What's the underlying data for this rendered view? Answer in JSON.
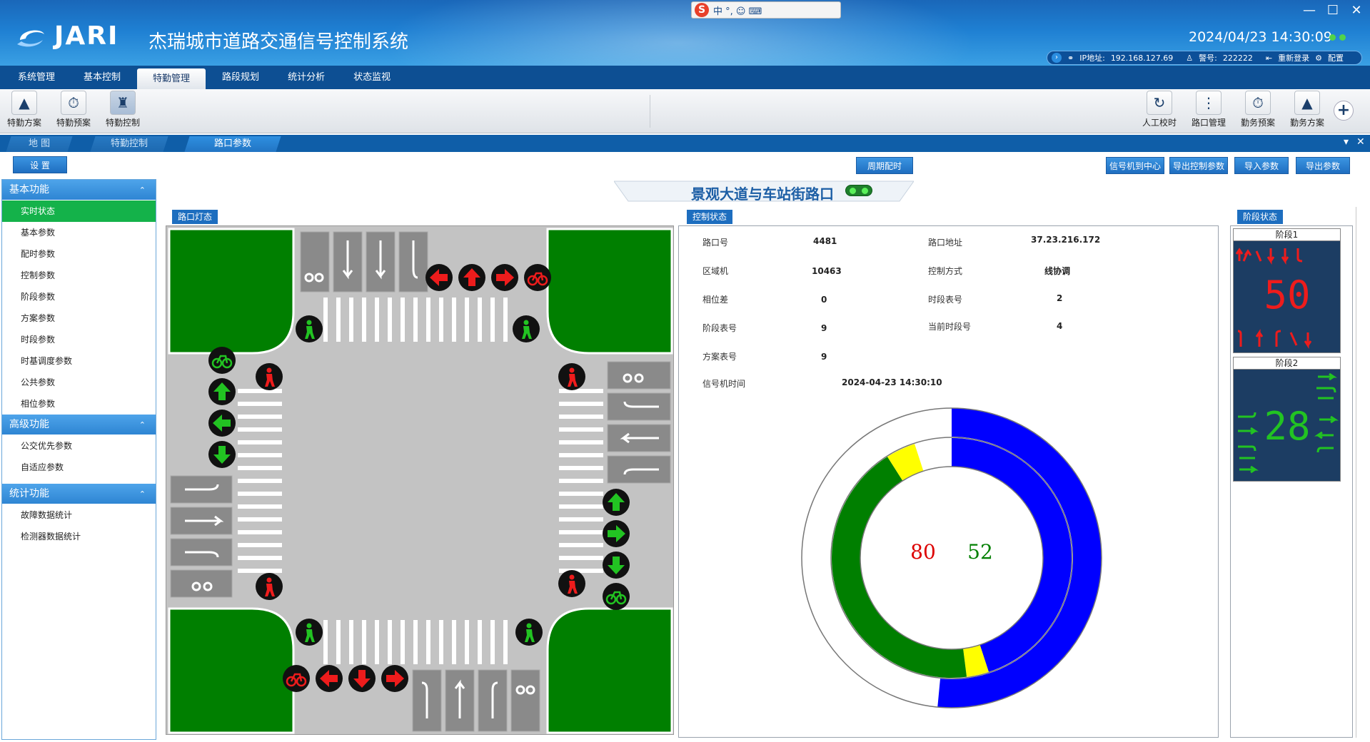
{
  "brand": {
    "logo_text": "JARI",
    "title": "杰瑞城市道路交通信号控制系统"
  },
  "ime": {
    "label": "中 °, ☺ ⌨"
  },
  "status": {
    "datetime": "2024/04/23 14:30:09",
    "ip_label": "IP地址:",
    "ip_value": "192.168.127.69",
    "badge_label": "警号:",
    "badge_value": "222222",
    "relogin": "重新登录",
    "config": "配置"
  },
  "menu": [
    "系统管理",
    "基本控制",
    "特勤管理",
    "路段规划",
    "统计分析",
    "状态监视"
  ],
  "toolbar_left": [
    "特勤方案",
    "特勤预案",
    "特勤控制"
  ],
  "toolbar_right": [
    "人工校时",
    "路口管理",
    "勤务预案",
    "勤务方案"
  ],
  "tabs": [
    "地 图",
    "特勤控制",
    "路口参数"
  ],
  "buttons": {
    "settings": "设 置",
    "cycle_timing": "周期配时",
    "signal_to_center": "信号机到中心",
    "export_control": "导出控制参数",
    "import_params": "导入参数",
    "export_params": "导出参数"
  },
  "sidebar": {
    "basic": {
      "title": "基本功能",
      "items": [
        "实时状态",
        "基本参数",
        "配时参数",
        "控制参数",
        "阶段参数",
        "方案参数",
        "时段参数",
        "时基调度参数",
        "公共参数",
        "相位参数"
      ]
    },
    "advanced": {
      "title": "高级功能",
      "items": [
        "公交优先参数",
        "自适应参数"
      ]
    },
    "stats": {
      "title": "统计功能",
      "items": [
        "故障数据统计",
        "检测器数据统计"
      ]
    }
  },
  "intersection_name": "景观大道与车站街路口",
  "sections": {
    "lamp_state": "路口灯态",
    "control_state": "控制状态",
    "stage_state": "阶段状态"
  },
  "control": {
    "junction_no_label": "路口号",
    "junction_no": "4481",
    "address_label": "路口地址",
    "address": "37.23.216.172",
    "region_label": "区域机",
    "region": "10463",
    "mode_label": "控制方式",
    "mode": "线协调",
    "offset_label": "相位差",
    "offset": "0",
    "period_table_label": "时段表号",
    "period_table": "2",
    "stage_table_label": "阶段表号",
    "stage_table": "9",
    "current_period_label": "当前时段号",
    "current_period": "4",
    "plan_table_label": "方案表号",
    "plan_table": "9",
    "clock_label": "信号机时间",
    "clock": "2024-04-23 14:30:10"
  },
  "ring": {
    "cycle": "80",
    "remaining": "52"
  },
  "ring_fractions": {
    "outer_blue_end": 0.515,
    "inner_blue_end": 0.45,
    "inner_yellow1_end": 0.48,
    "inner_green_end": 0.91,
    "inner_yellow2_end": 0.95
  },
  "stages": [
    {
      "title": "阶段1",
      "countdown": "50"
    },
    {
      "title": "阶段2",
      "countdown": "28"
    }
  ],
  "colors": {
    "red": "#ee1c1c",
    "green": "#22c322",
    "blue": "#0000ff",
    "yellow": "#ffff00",
    "ring_green": "#007f00"
  }
}
